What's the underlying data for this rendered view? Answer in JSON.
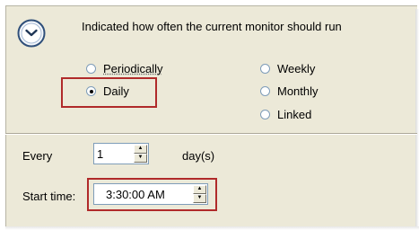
{
  "header": {
    "icon": "clock-icon",
    "description": "Indicated how often the current monitor should run"
  },
  "frequency": {
    "options": [
      {
        "label": "Periodically",
        "checked": false
      },
      {
        "label": "Daily",
        "checked": true
      },
      {
        "label": "Weekly",
        "checked": false
      },
      {
        "label": "Monthly",
        "checked": false
      },
      {
        "label": "Linked",
        "checked": false
      }
    ]
  },
  "every": {
    "label": "Every",
    "value": "1",
    "unit": "day(s)"
  },
  "start_time": {
    "label": "Start time:",
    "value": "3:30:00 AM"
  },
  "colors": {
    "highlight": "#b02a2a",
    "panel": "#ece9d8"
  }
}
